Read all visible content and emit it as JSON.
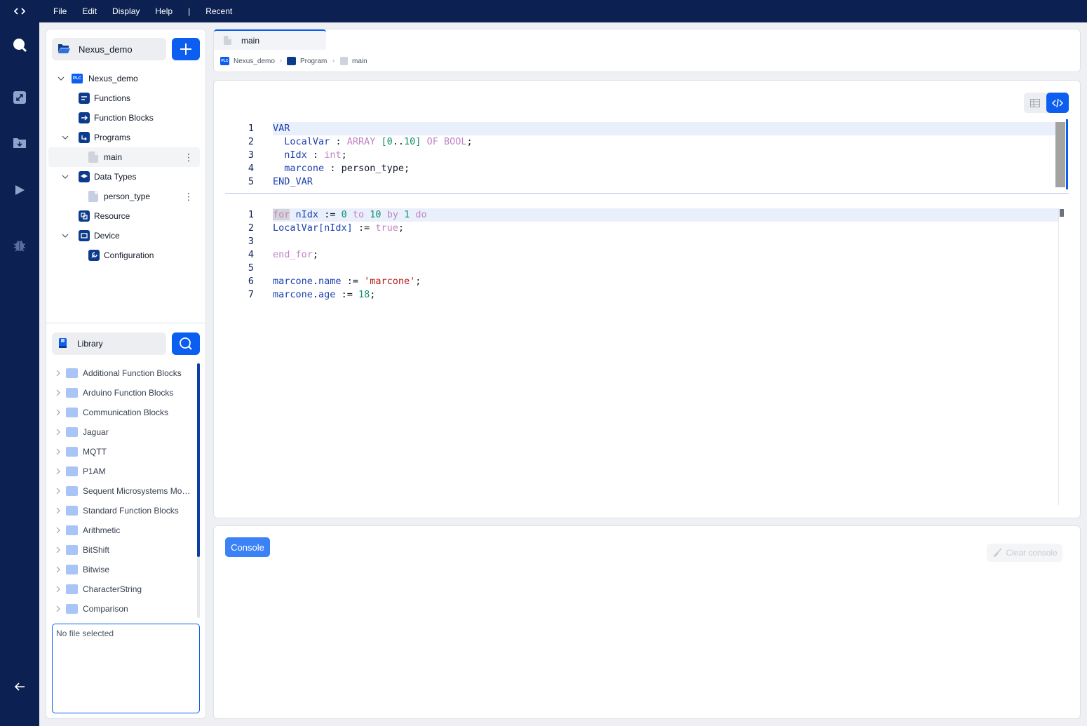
{
  "menu": {
    "items": [
      "File",
      "Edit",
      "Display",
      "Help"
    ],
    "separator": "|",
    "recent": "Recent"
  },
  "project": {
    "name": "Nexus_demo",
    "tree": {
      "root": "Nexus_demo",
      "root_badge": "PLC",
      "functions": "Functions",
      "function_blocks": "Function Blocks",
      "programs": "Programs",
      "program_main": "main",
      "data_types": "Data Types",
      "dt_person": "person_type",
      "resource": "Resource",
      "device": "Device",
      "configuration": "Configuration",
      "more_glyph": "⋮"
    }
  },
  "library": {
    "title": "Library",
    "items": [
      "Additional Function Blocks",
      "Arduino Function Blocks",
      "Communication Blocks",
      "Jaguar",
      "MQTT",
      "P1AM",
      "Sequent Microsystems Modules",
      "Standard Function Blocks",
      "Arithmetic",
      "BitShift",
      "Bitwise",
      "CharacterString",
      "Comparison"
    ],
    "file_box": "No file selected"
  },
  "editor": {
    "tab": "main",
    "breadcrumb": [
      "Nexus_demo",
      "Program",
      "main"
    ],
    "breadcrumb_badge": "PLC",
    "breadcrumb_sep": "›",
    "var_lines": [
      "1",
      "2",
      "3",
      "4",
      "5"
    ],
    "body_lines": [
      "1",
      "2",
      "3",
      "4",
      "5",
      "6",
      "7"
    ]
  },
  "console": {
    "button": "Console",
    "clear": "Clear console"
  },
  "colors": {
    "nav": "#0c2152",
    "accent": "#0b5ef0"
  }
}
